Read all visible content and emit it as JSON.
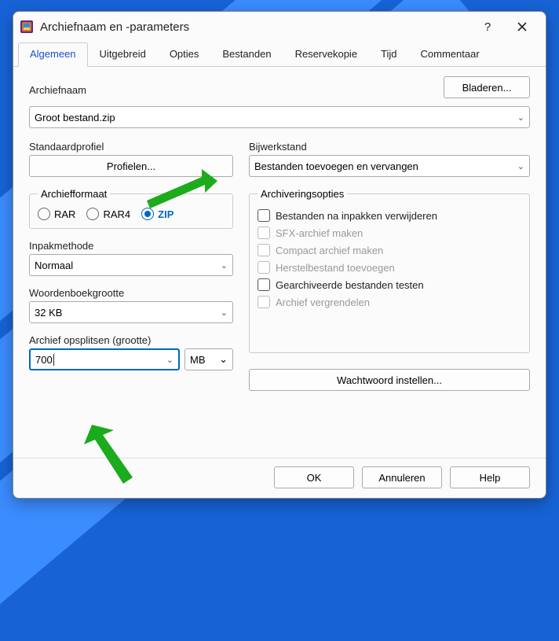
{
  "window": {
    "title": "Archiefnaam en -parameters"
  },
  "tabs": [
    "Algemeen",
    "Uitgebreid",
    "Opties",
    "Bestanden",
    "Reservekopie",
    "Tijd",
    "Commentaar"
  ],
  "archive_name": {
    "label": "Archiefnaam",
    "value": "Groot bestand.zip",
    "browse": "Bladeren..."
  },
  "profile": {
    "label": "Standaardprofiel",
    "button": "Profielen..."
  },
  "update_mode": {
    "label": "Bijwerkstand",
    "value": "Bestanden toevoegen en vervangen"
  },
  "format": {
    "legend": "Archiefformaat",
    "options": [
      "RAR",
      "RAR4",
      "ZIP"
    ],
    "selected": "ZIP"
  },
  "method": {
    "label": "Inpakmethode",
    "value": "Normaal"
  },
  "dict": {
    "label": "Woordenboekgrootte",
    "value": "32 KB"
  },
  "split": {
    "label": "Archief opsplitsen (grootte)",
    "value": "700",
    "unit": "MB"
  },
  "options": {
    "legend": "Archiveringsopties",
    "items": [
      {
        "label": "Bestanden na inpakken verwijderen",
        "disabled": false
      },
      {
        "label": "SFX-archief maken",
        "disabled": true
      },
      {
        "label": "Compact archief maken",
        "disabled": true
      },
      {
        "label": "Herstelbestand toevoegen",
        "disabled": true
      },
      {
        "label": "Gearchiveerde bestanden testen",
        "disabled": false
      },
      {
        "label": "Archief vergrendelen",
        "disabled": true
      }
    ]
  },
  "password_btn": "Wachtwoord instellen...",
  "footer": {
    "ok": "OK",
    "cancel": "Annuleren",
    "help": "Help"
  }
}
